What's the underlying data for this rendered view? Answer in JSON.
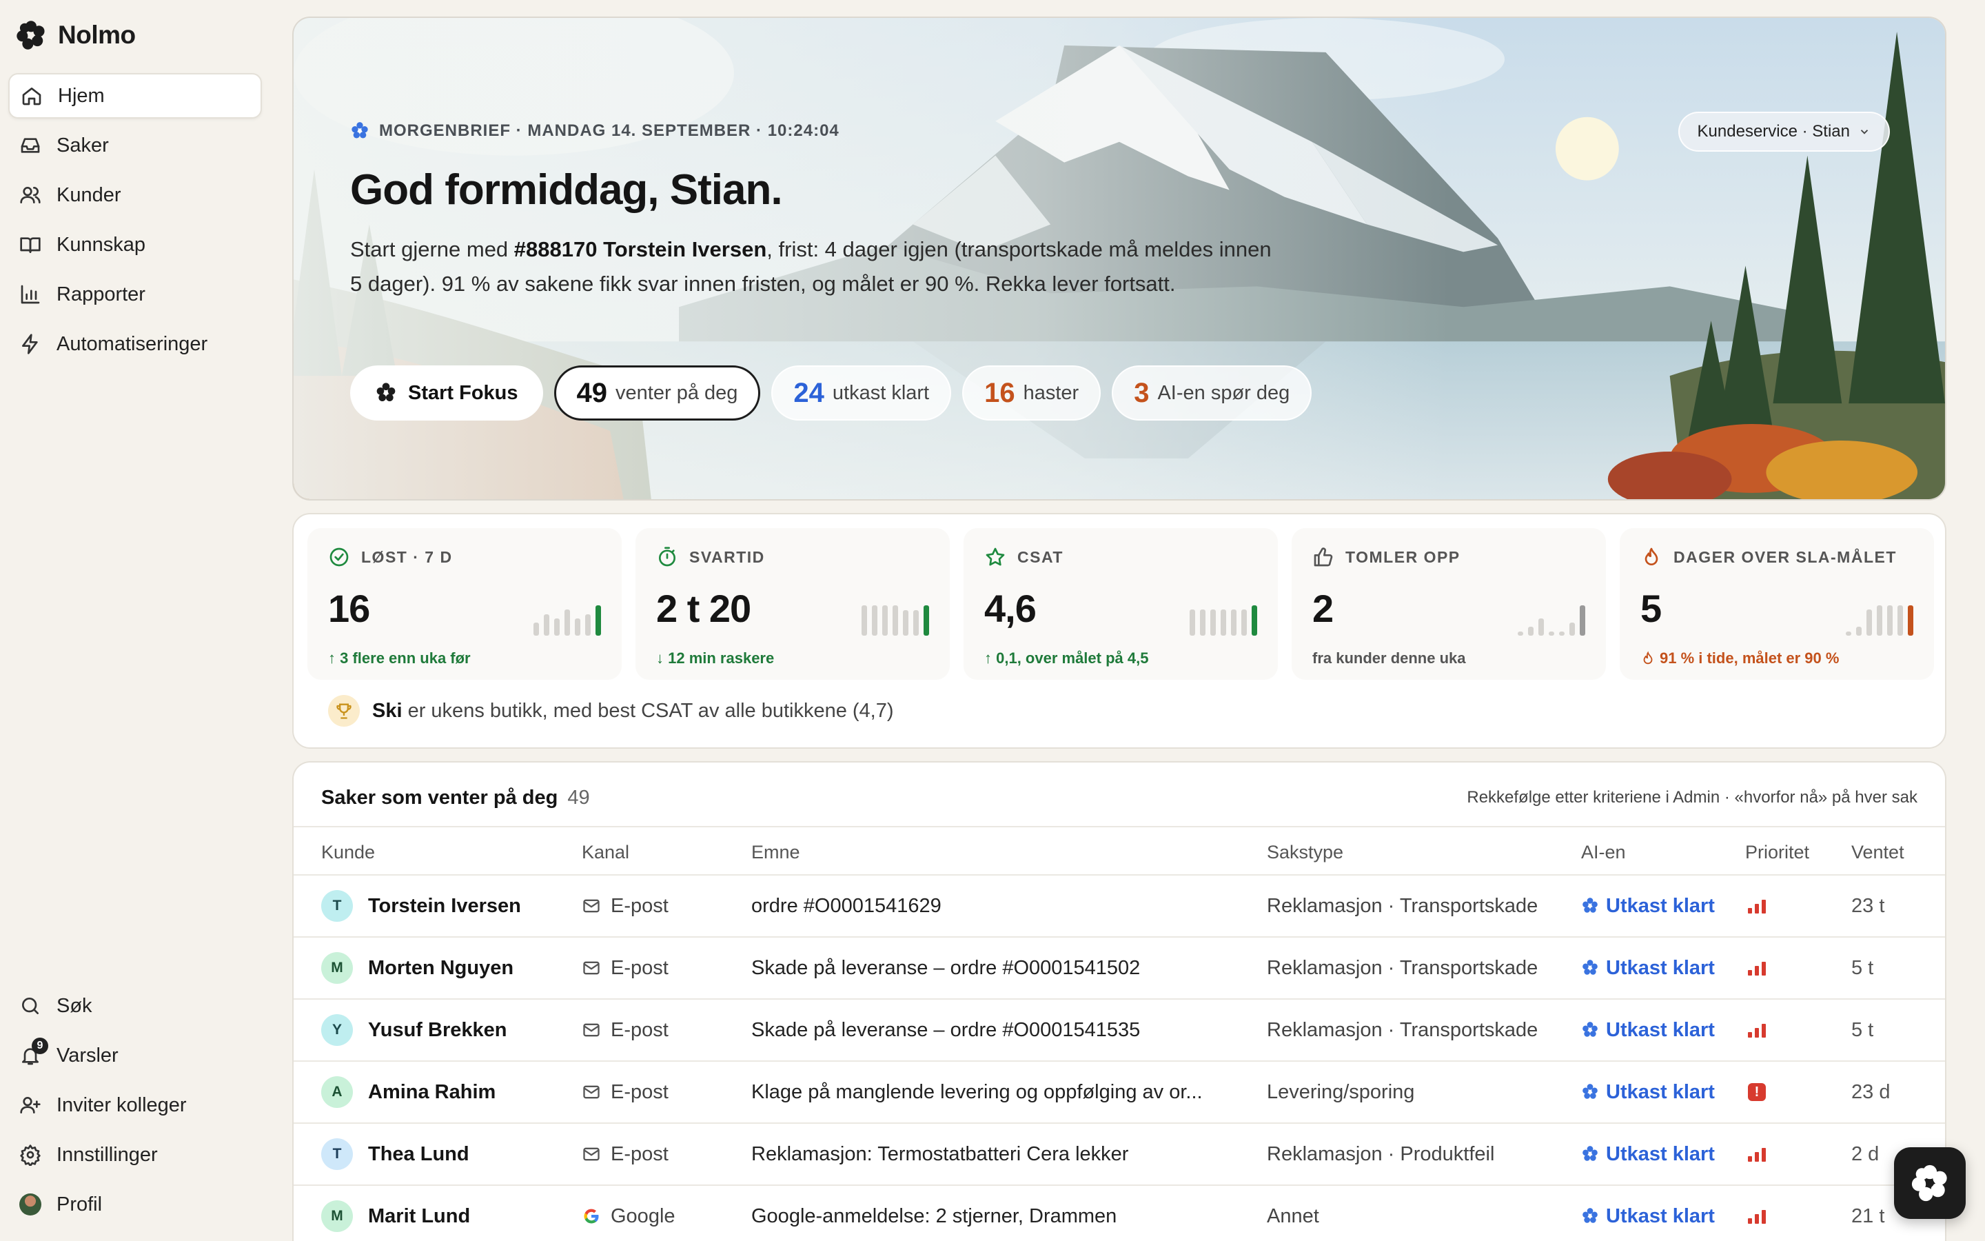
{
  "brand": {
    "name": "Nolmo"
  },
  "nav": {
    "items": [
      {
        "label": "Hjem"
      },
      {
        "label": "Saker"
      },
      {
        "label": "Kunder"
      },
      {
        "label": "Kunnskap"
      },
      {
        "label": "Rapporter"
      },
      {
        "label": "Automatiseringer"
      }
    ],
    "bottom": [
      {
        "label": "Søk"
      },
      {
        "label": "Varsler",
        "badge": "9"
      },
      {
        "label": "Inviter kolleger"
      },
      {
        "label": "Innstillinger"
      },
      {
        "label": "Profil"
      }
    ]
  },
  "hero": {
    "brief": "MORGENBRIEF · MANDAG 14. SEPTEMBER ·  10:24:04",
    "greeting": "God formiddag, Stian.",
    "summary_pre": "Start gjerne med ",
    "summary_case": "#888170 Torstein Iversen",
    "summary_post": ", frist: 4 dager igjen (transportskade må meldes innen 5 dager). 91 % av sakene fikk svar innen fristen, og målet er 90 %. Rekka lever fortsatt.",
    "team": "Kundeservice · Stian",
    "start_label": "Start Fokus",
    "pills": {
      "waiting": {
        "num": "49",
        "label": "venter på deg"
      },
      "drafts": {
        "num": "24",
        "label": "utkast klart"
      },
      "urgent": {
        "num": "16",
        "label": "haster"
      },
      "ai": {
        "num": "3",
        "label": "AI-en spør deg"
      }
    }
  },
  "stats": [
    {
      "label": "LØST · 7 D",
      "value": "16",
      "sub": "↑ 3 flere enn uka før",
      "tone": "green",
      "accent": "#1f8a3f",
      "bars": [
        3,
        5,
        4,
        6,
        4,
        5,
        7
      ]
    },
    {
      "label": "SVARTID",
      "value": "2 t 20",
      "sub": "↓ 12 min raskere",
      "tone": "green",
      "accent": "#1f8a3f",
      "bars": [
        6,
        6,
        6,
        6,
        5,
        5,
        6
      ]
    },
    {
      "label": "CSAT",
      "value": "4,6",
      "sub": "↑ 0,1, over målet på 4,5",
      "tone": "green",
      "accent": "#1f8a3f",
      "bars": [
        6,
        6,
        6,
        6,
        6,
        6,
        7
      ]
    },
    {
      "label": "TOMLER OPP",
      "value": "2",
      "sub": "fra kunder denne uka",
      "tone": "grey",
      "accent": "#9a9a9a",
      "bars": [
        1,
        2,
        4,
        1,
        1,
        3,
        7
      ]
    },
    {
      "label": "DAGER OVER SLA-MÅLET",
      "value": "5",
      "sub": "91 % i tide, målet er 90 %",
      "tone": "orange",
      "accent": "#c4521c",
      "bars": [
        1,
        2,
        6,
        7,
        7,
        7,
        7
      ]
    }
  ],
  "trophy": {
    "store": "Ski",
    "text": " er ukens butikk, med best CSAT av alle butikkene (4,7)"
  },
  "queue": {
    "title": "Saker som venter på deg",
    "count": "49",
    "note": "Rekkefølge etter kriteriene i Admin · «hvorfor nå» på hver sak",
    "columns": [
      "Kunde",
      "Kanal",
      "Emne",
      "Sakstype",
      "AI-en",
      "Prioritet",
      "Ventet"
    ],
    "rows": [
      {
        "initial": "T",
        "customer": "Torstein Iversen",
        "channel": "E-post",
        "channel_icon": "mail-icon",
        "subject": "ordre #O0001541629",
        "type": "Reklamasjon · Transportskade",
        "ai": "Utkast klart",
        "priority": "high",
        "waited": "23 t",
        "av": "teal"
      },
      {
        "initial": "M",
        "customer": "Morten Nguyen",
        "channel": "E-post",
        "channel_icon": "mail-icon",
        "subject": "Skade på leveranse – ordre #O0001541502",
        "type": "Reklamasjon · Transportskade",
        "ai": "Utkast klart",
        "priority": "high",
        "waited": "5 t",
        "av": "green"
      },
      {
        "initial": "Y",
        "customer": "Yusuf Brekken",
        "channel": "E-post",
        "channel_icon": "mail-icon",
        "subject": "Skade på leveranse – ordre #O0001541535",
        "type": "Reklamasjon · Transportskade",
        "ai": "Utkast klart",
        "priority": "high",
        "waited": "5 t",
        "av": "teal"
      },
      {
        "initial": "A",
        "customer": "Amina Rahim",
        "channel": "E-post",
        "channel_icon": "mail-icon",
        "subject": "Klage på manglende levering og oppfølging av or...",
        "type": "Levering/sporing",
        "ai": "Utkast klart",
        "priority": "urgent",
        "waited": "23 d",
        "av": "green"
      },
      {
        "initial": "T",
        "customer": "Thea Lund",
        "channel": "E-post",
        "channel_icon": "mail-icon",
        "subject": "Reklamasjon: Termostatbatteri Cera lekker",
        "type": "Reklamasjon · Produktfeil",
        "ai": "Utkast klart",
        "priority": "high",
        "waited": "2 d",
        "av": "blue"
      },
      {
        "initial": "M",
        "customer": "Marit Lund",
        "channel": "Google",
        "channel_icon": "google-icon",
        "subject": "Google-anmeldelse: 2 stjerner, Drammen",
        "type": "Annet",
        "ai": "Utkast klart",
        "priority": "high",
        "waited": "21 t",
        "av": "green"
      }
    ]
  }
}
